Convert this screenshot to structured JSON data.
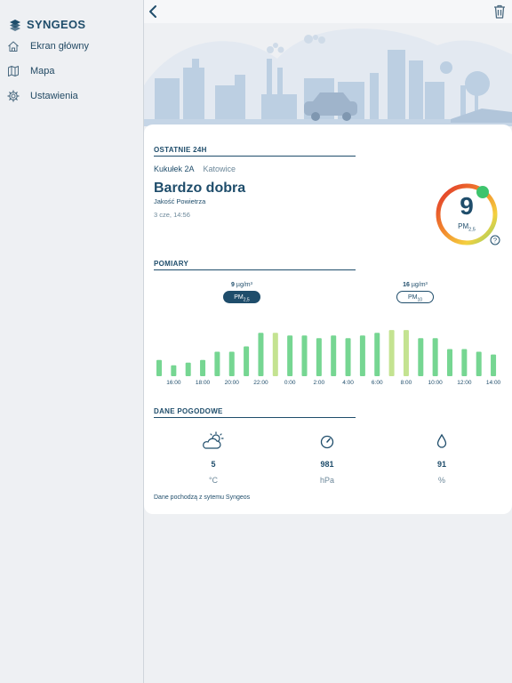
{
  "app": {
    "brand": "SYNGEOS"
  },
  "sidebar": {
    "items": [
      {
        "label": "Ekran główny",
        "icon": "home-icon"
      },
      {
        "label": "Mapa",
        "icon": "map-icon"
      },
      {
        "label": "Ustawienia",
        "icon": "settings-gear-icon"
      }
    ]
  },
  "toolbar": {
    "back_icon": "chevron-left-icon",
    "delete_icon": "trash-icon"
  },
  "card": {
    "last24_title": "OSTATNIE 24H",
    "station_name": "Kukułek 2A",
    "station_city": "Katowice",
    "quality_label": "Bardzo dobra",
    "quality_sublabel": "Jakość Powietrza",
    "timestamp": "3 cze, 14:56",
    "gauge": {
      "value": "9",
      "unit": "PM",
      "unit_sub": "2,5"
    },
    "measurements_title": "POMIARY",
    "pm25": {
      "value": "9",
      "unit": "µg/m³",
      "label": "PM",
      "label_sub": "2,5",
      "selected": true
    },
    "pm10": {
      "value": "16",
      "unit": "µg/m³",
      "label": "PM",
      "label_sub": "10",
      "selected": false
    },
    "weather_title": "DANE POGODOWE",
    "weather": [
      {
        "icon": "partly-cloudy-icon",
        "value": "5",
        "unit": "°C"
      },
      {
        "icon": "pressure-gauge-icon",
        "value": "981",
        "unit": "hPa"
      },
      {
        "icon": "humidity-drop-icon",
        "value": "91",
        "unit": "%"
      }
    ],
    "source_note": "Dane pochodzą z sytemu Syngeos"
  },
  "colors": {
    "primary": "#1f4d6b",
    "bar_good": "#76d692",
    "bar_moderate": "#c4e391"
  },
  "chart_data": {
    "type": "bar",
    "series": [
      {
        "values": [
          6,
          4,
          5,
          6,
          9,
          9,
          11,
          16,
          16,
          15,
          15,
          14,
          15,
          14,
          15,
          16,
          17,
          17,
          14,
          14,
          10,
          10,
          9,
          8
        ]
      }
    ],
    "levels": [
      "good",
      "good",
      "good",
      "good",
      "good",
      "good",
      "good",
      "good",
      "moderate",
      "good",
      "good",
      "good",
      "good",
      "good",
      "good",
      "good",
      "moderate",
      "moderate",
      "good",
      "good",
      "good",
      "good",
      "good",
      "good"
    ],
    "tick_labels": [
      "16:00",
      "18:00",
      "20:00",
      "22:00",
      "0:00",
      "2:00",
      "4:00",
      "6:00",
      "8:00",
      "10:00",
      "12:00",
      "14:00"
    ],
    "ylim": [
      0,
      20
    ]
  }
}
